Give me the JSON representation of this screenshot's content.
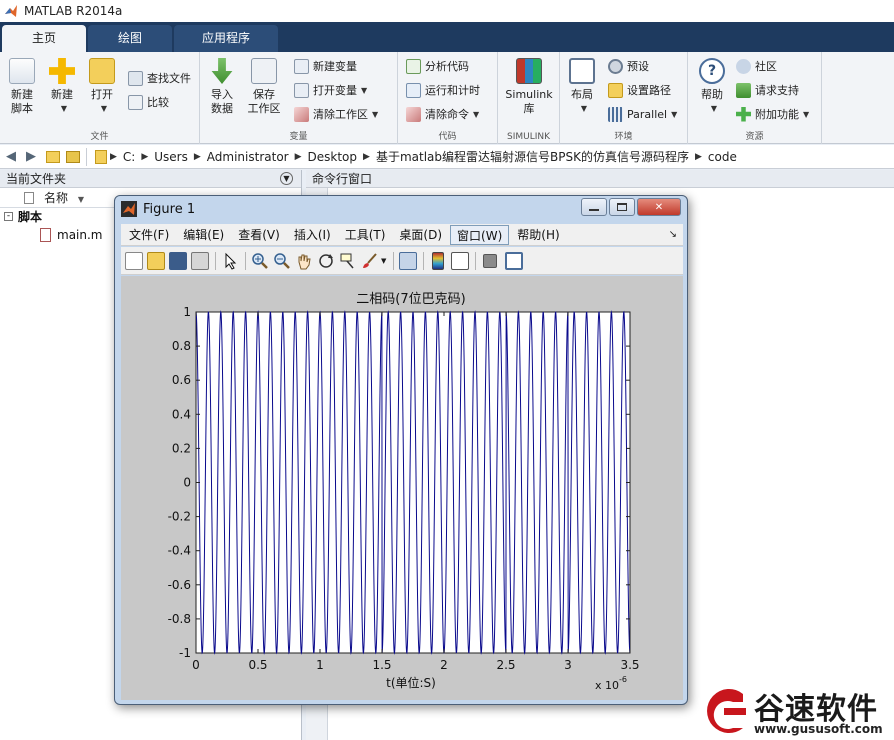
{
  "app": {
    "title": "MATLAB R2014a"
  },
  "tabs": [
    {
      "label": "主页",
      "active": true
    },
    {
      "label": "绘图",
      "active": false
    },
    {
      "label": "应用程序",
      "active": false
    }
  ],
  "ribbon": {
    "file": {
      "group_label": "文件",
      "new_script": "新建\n脚本",
      "new": "新建",
      "open": "打开",
      "find_files": "查找文件",
      "compare": "比较"
    },
    "variable": {
      "group_label": "变量",
      "import": "导入\n数据",
      "save_workspace": "保存\n工作区",
      "new_variable": "新建变量",
      "open_variable": "打开变量",
      "clear_workspace": "清除工作区"
    },
    "code": {
      "group_label": "代码",
      "analyze": "分析代码",
      "run_time": "运行和计时",
      "clear_commands": "清除命令"
    },
    "simulink": {
      "group_label": "SIMULINK",
      "library": "Simulink\n库"
    },
    "environment": {
      "group_label": "环境",
      "layout": "布局",
      "preferences": "预设",
      "set_path": "设置路径",
      "parallel": "Parallel"
    },
    "resources": {
      "group_label": "资源",
      "help": "帮助",
      "community": "社区",
      "request_support": "请求支持",
      "addons": "附加功能"
    }
  },
  "path": [
    "C:",
    "Users",
    "Administrator",
    "Desktop",
    "基于matlab编程雷达辐射源信号BPSK的仿真信号源码程序",
    "code"
  ],
  "left_panel": {
    "title": "当前文件夹",
    "column_name": "名称",
    "folder": "脚本",
    "file": "main.m"
  },
  "right_panel": {
    "title": "命令行窗口"
  },
  "figure": {
    "title": "Figure 1",
    "menus": [
      "文件(F)",
      "编辑(E)",
      "查看(V)",
      "插入(I)",
      "工具(T)",
      "桌面(D)",
      "窗口(W)",
      "帮助(H)"
    ],
    "highlighted_menu_index": 6,
    "toolbar_icons": [
      "new-figure-icon",
      "open-icon",
      "save-icon",
      "print-icon",
      "pointer-icon",
      "zoom-in-icon",
      "zoom-out-icon",
      "pan-icon",
      "rotate-icon",
      "data-cursor-icon",
      "brush-icon",
      "link-plot-icon",
      "colorbar-icon",
      "legend-icon",
      "hide-plot-tools-icon",
      "show-plot-tools-icon"
    ]
  },
  "chart_data": {
    "type": "line",
    "title": "二相码(7位巴克码)",
    "xlabel": "t(单位:S)",
    "ylabel": "",
    "x_exponent_label": "x 10",
    "x_exponent_power": "-6",
    "xlim": [
      0,
      3.5
    ],
    "ylim": [
      -1,
      1
    ],
    "xticks": [
      "0",
      "0.5",
      "1",
      "1.5",
      "2",
      "2.5",
      "3",
      "3.5"
    ],
    "yticks": [
      "1",
      "0.8",
      "0.6",
      "0.4",
      "0.2",
      "0",
      "-0.2",
      "-0.4",
      "-0.6",
      "-0.8",
      "-1"
    ],
    "line_color": "#0a0a8c",
    "signal": "BPSK carrier modulated by 7-bit Barker code",
    "carrier_cycles": 35,
    "duration": 3.5
  },
  "watermark": {
    "name": "谷速软件",
    "url": "www.gususoft.com"
  }
}
